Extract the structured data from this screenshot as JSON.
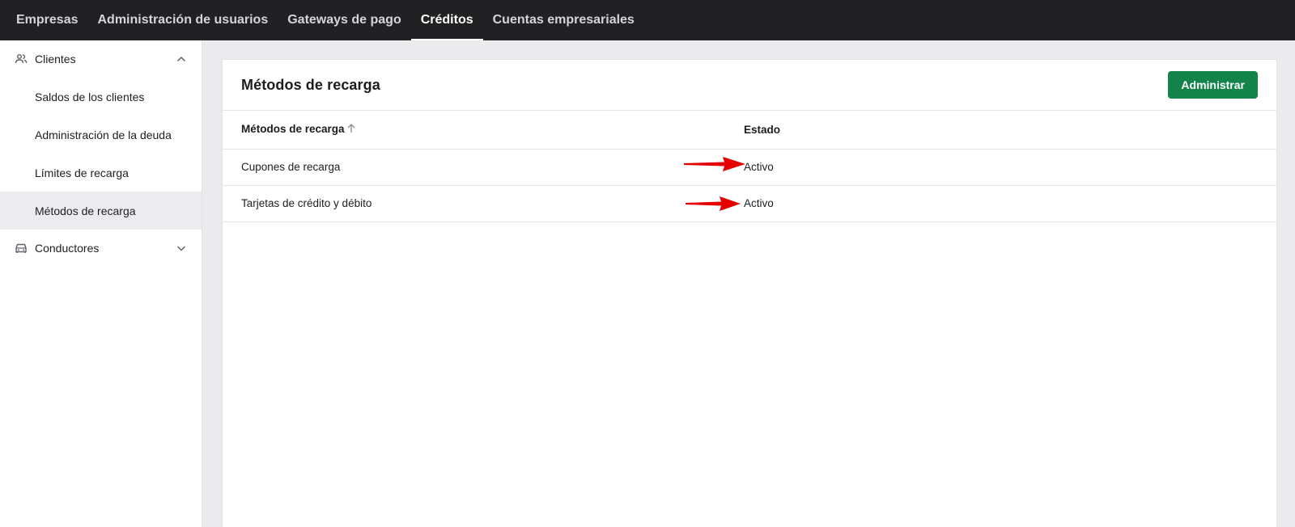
{
  "topnav": {
    "tabs": [
      {
        "label": "Empresas",
        "active": false
      },
      {
        "label": "Administración de usuarios",
        "active": false
      },
      {
        "label": "Gateways de pago",
        "active": false
      },
      {
        "label": "Créditos",
        "active": true
      },
      {
        "label": "Cuentas empresariales",
        "active": false
      }
    ]
  },
  "sidebar": {
    "groups": [
      {
        "label": "Clientes",
        "icon": "people-icon",
        "expanded": true,
        "items": [
          {
            "label": "Saldos de los clientes",
            "active": false
          },
          {
            "label": "Administración de la deuda",
            "active": false
          },
          {
            "label": "Límites de recarga",
            "active": false
          },
          {
            "label": "Métodos de recarga",
            "active": true
          }
        ]
      },
      {
        "label": "Conductores",
        "icon": "car-icon",
        "expanded": false,
        "items": []
      }
    ]
  },
  "main": {
    "title": "Métodos de recarga",
    "admin_button": "Administrar",
    "table": {
      "columns": [
        "Métodos de recarga",
        "Estado"
      ],
      "sort": {
        "column": "Métodos de recarga",
        "direction": "ascending"
      },
      "rows": [
        {
          "method": "Cupones de recarga",
          "status": "Activo"
        },
        {
          "method": "Tarjetas de crédito y débito",
          "status": "Activo"
        }
      ]
    }
  },
  "colors": {
    "topbar_bg": "#212124",
    "accent_green": "#12844a",
    "annotation_arrow": "#e50000",
    "active_item_bg": "#ececee"
  }
}
